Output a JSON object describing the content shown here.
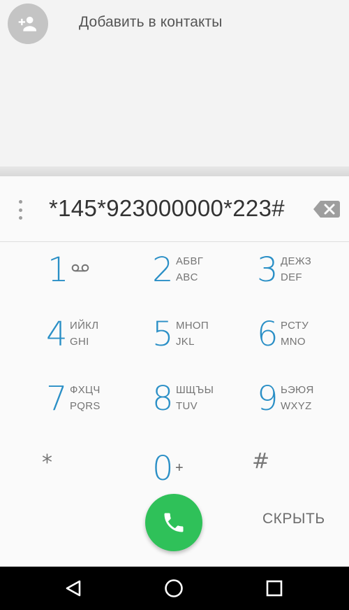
{
  "header": {
    "add_contact_label": "Добавить в контакты",
    "add_contact_icon": "person-add-icon"
  },
  "dialpad": {
    "entered_number": "*145*923000000*223#",
    "overflow_icon": "more-vert-icon",
    "backspace_icon": "backspace-icon",
    "keys": [
      {
        "digit": "1",
        "icon": "voicemail-icon"
      },
      {
        "digit": "2",
        "letters_ru": "АБВГ",
        "letters_en": "ABC"
      },
      {
        "digit": "3",
        "letters_ru": "ДЕЖЗ",
        "letters_en": "DEF"
      },
      {
        "digit": "4",
        "letters_ru": "ИЙКЛ",
        "letters_en": "GHI"
      },
      {
        "digit": "5",
        "letters_ru": "МНОП",
        "letters_en": "JKL"
      },
      {
        "digit": "6",
        "letters_ru": "РСТУ",
        "letters_en": "MNO"
      },
      {
        "digit": "7",
        "letters_ru": "ФХЦЧ",
        "letters_en": "PQRS"
      },
      {
        "digit": "8",
        "letters_ru": "ШЩЪЫ",
        "letters_en": "TUV"
      },
      {
        "digit": "9",
        "letters_ru": "ЬЭЮЯ",
        "letters_en": "WXYZ"
      },
      {
        "digit": "*"
      },
      {
        "digit": "0",
        "sub": "+"
      },
      {
        "digit": "#"
      }
    ],
    "call_icon": "phone-icon",
    "hide_label": "СКРЫТЬ"
  },
  "nav": {
    "back_icon": "back-triangle-icon",
    "home_icon": "home-circle-icon",
    "recents_icon": "recents-square-icon"
  },
  "colors": {
    "digit": "#2a8fc6",
    "call_button": "#2fc159",
    "nav_bar": "#000000"
  }
}
